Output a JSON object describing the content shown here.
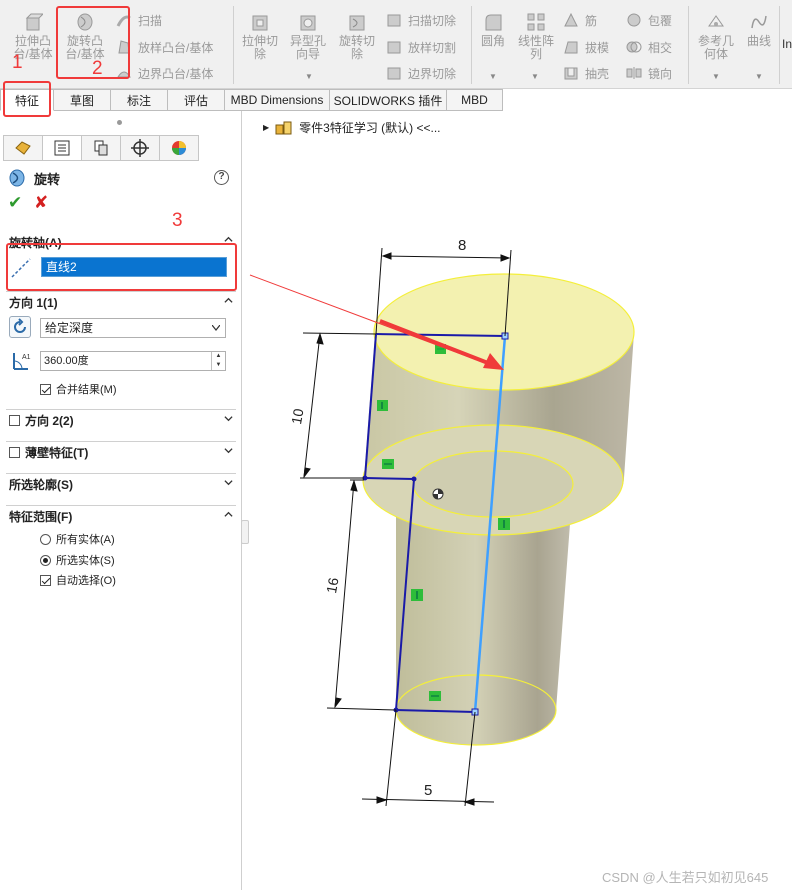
{
  "ribbon": {
    "large": [
      {
        "label": "拉伸凸\n台/基体",
        "icon": "extrude-boss-icon"
      },
      {
        "label": "旋转凸\n台/基体",
        "icon": "revolve-boss-icon"
      }
    ],
    "boss_rows": [
      "扫描",
      "放样凸台/基体",
      "边界凸台/基体"
    ],
    "cut_large": [
      {
        "label": "拉伸切\n除",
        "icon": "extrude-cut-icon"
      },
      {
        "label": "异型孔\n向导",
        "icon": "hole-wizard-icon"
      },
      {
        "label": "旋转切\n除",
        "icon": "revolve-cut-icon"
      }
    ],
    "cut_rows": [
      "扫描切除",
      "放样切割",
      "边界切除"
    ],
    "fillet": "圆角",
    "pattern": "线性阵\n列",
    "col3": [
      "筋",
      "拔模",
      "抽壳"
    ],
    "col4": [
      "包覆",
      "相交",
      "镜向"
    ],
    "ref_geom": "参考几\n何体",
    "curves": "曲线",
    "overflow": "In"
  },
  "tabs": [
    "特征",
    "草图",
    "标注",
    "评估",
    "MBD Dimensions",
    "SOLIDWORKS 插件",
    "MBD"
  ],
  "panel": {
    "title": "旋转",
    "help": "?",
    "ok": "✔",
    "cancel": "✘",
    "axis_section": "旋转轴(A)",
    "axis_value": "直线2",
    "dir1_section": "方向 1(1)",
    "end_condition": "给定深度",
    "angle": "360.00度",
    "merge": "合并结果(M)",
    "dir2_section": "方向 2(2)",
    "thin_section": "薄壁特征(T)",
    "contours_section": "所选轮廓(S)",
    "scope_section": "特征范围(F)",
    "scope_all": "所有实体(A)",
    "scope_selected": "所选实体(S)",
    "auto_select": "自动选择(O)"
  },
  "tree": {
    "label": "零件3特征学习 (默认) <<..."
  },
  "annotations": {
    "step1": "1",
    "step2": "2",
    "step3": "3"
  },
  "dimensions": {
    "top": "8",
    "upper": "10",
    "lower": "16",
    "bottom": "5"
  },
  "watermark": "CSDN @人生若只如初见645",
  "colors": {
    "accent_red": "#f03a3a",
    "sketch_blue": "#1a1aa8",
    "axis_highlight": "#3fa0ff",
    "face_yellow": "#f3f1b0"
  }
}
